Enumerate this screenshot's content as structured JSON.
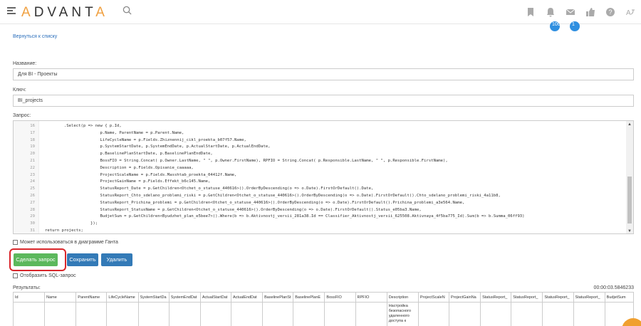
{
  "header": {
    "logo_prefix": "A",
    "logo_middle": "DVANT",
    "logo_suffix": "A",
    "badge_messages": "100",
    "badge_notifications": "1"
  },
  "back_link": "Вернуться к списку",
  "name_label": "Название:",
  "name_value": "Для BI - Проекты",
  "key_label": "Ключ:",
  "key_value": "BI_projects",
  "query_label": "Запрос:",
  "code_lines": [
    {
      "n": "16",
      "t": "        .Select(p => new { p.Id,"
    },
    {
      "n": "17",
      "t": "                       p.Name, ParentName = p.Parent.Name,"
    },
    {
      "n": "18",
      "t": "                       LifeCycleName = p.Fields.Zhiznennij_cikl_proekta_b07f57.Name,"
    },
    {
      "n": "19",
      "t": "                       p.SystemStartDate, p.SystemEndDate, p.ActualStartDate, p.ActualEndDate,"
    },
    {
      "n": "20",
      "t": "                       p.BaselinePlanStartDate, p.BaselinePlanEndDate,"
    },
    {
      "n": "21",
      "t": "                       BossFIO = String.Concat( p.Owner.LastName, \" \", p.Owner.FirstName), RPFIO = String.Concat( p.Responsible.LastName, \" \", p.Responsible.FirstName),"
    },
    {
      "n": "22",
      "t": "                       Description = p.Fields.Opisanie_caaaaa,"
    },
    {
      "n": "23",
      "t": "                       ProjectScaleName = p.Fields.Masshtab_proekta_04412f.Name,"
    },
    {
      "n": "24",
      "t": "                       ProjectGainName = p.Fields.Effekt_b6c145.Name,"
    },
    {
      "n": "25",
      "t": "                       StatusReport_Date = p.GetChildren<Otchet_o_statuse_440616>().OrderByDescending(o => o.Date).FirstOrDefault().Date,"
    },
    {
      "n": "26",
      "t": "                       StatusReport_Chto_sdelano_problemi_riski = p.GetChildren<Otchet_o_statuse_440616>().OrderByDescending(o => o.Date).FirstOrDefault().Chto_sdelano_problemi_riski_4a11b8,"
    },
    {
      "n": "27",
      "t": "                       StatusReport_Prichina_problemi = p.GetChildren<Otchet_o_statuse_440616>().OrderByDescending(o => o.Date).FirstOrDefault().Prichina_problemi_a3e564.Name,"
    },
    {
      "n": "28",
      "t": "                       StatusReport_StatusName = p.GetChildren<Otchet_o_statuse_440616>().OrderByDescending(o => o.Date).FirstOrDefault().Status_e05ba3.Name,"
    },
    {
      "n": "29",
      "t": "                       BudjetSum = p.GetChildren<Byudzhet_plan_e5bee7>().Where(b => b.Aktivnostj_versii_281a38.Id == Classifier_Aktivnostj_versii_625508.Aktivnaya_4f5ba775_Id).Sum(b => b.Summa_06ff93)"
    },
    {
      "n": "30",
      "t": "                   });"
    },
    {
      "n": "31",
      "t": "return projects;"
    }
  ],
  "gantt_checkbox": "Может использоваться в диаграмме Ганта",
  "buttons": {
    "run": "Сделать запрос",
    "save": "Сохранить",
    "delete": "Удалить"
  },
  "sql_checkbox": "Отобразить SQL-запрос",
  "results_label": "Результаты:",
  "timer": "00:00:03.5846233",
  "table": {
    "headers": [
      "Id",
      "Name",
      "ParentName",
      "LifeCycleName",
      "SystemStartDa",
      "SystemEndDat",
      "ActualStartDat",
      "ActualEndDat",
      "BaselinePlanSt",
      "BaselinePlanE",
      "BossFIO",
      "RPFIO",
      "Description",
      "ProjectScaleN",
      "ProjectGainNa",
      "StatusReport_",
      "StatusReport_",
      "StatusReport_",
      "StatusReport_",
      "BudjetSum"
    ],
    "row_description": "Настройка безопасного удаленного доступа к"
  },
  "colors": {
    "accent_orange": "#f0a040",
    "primary_blue": "#337ab7",
    "success_green": "#5cb85c",
    "highlight_red": "#d9262b"
  }
}
